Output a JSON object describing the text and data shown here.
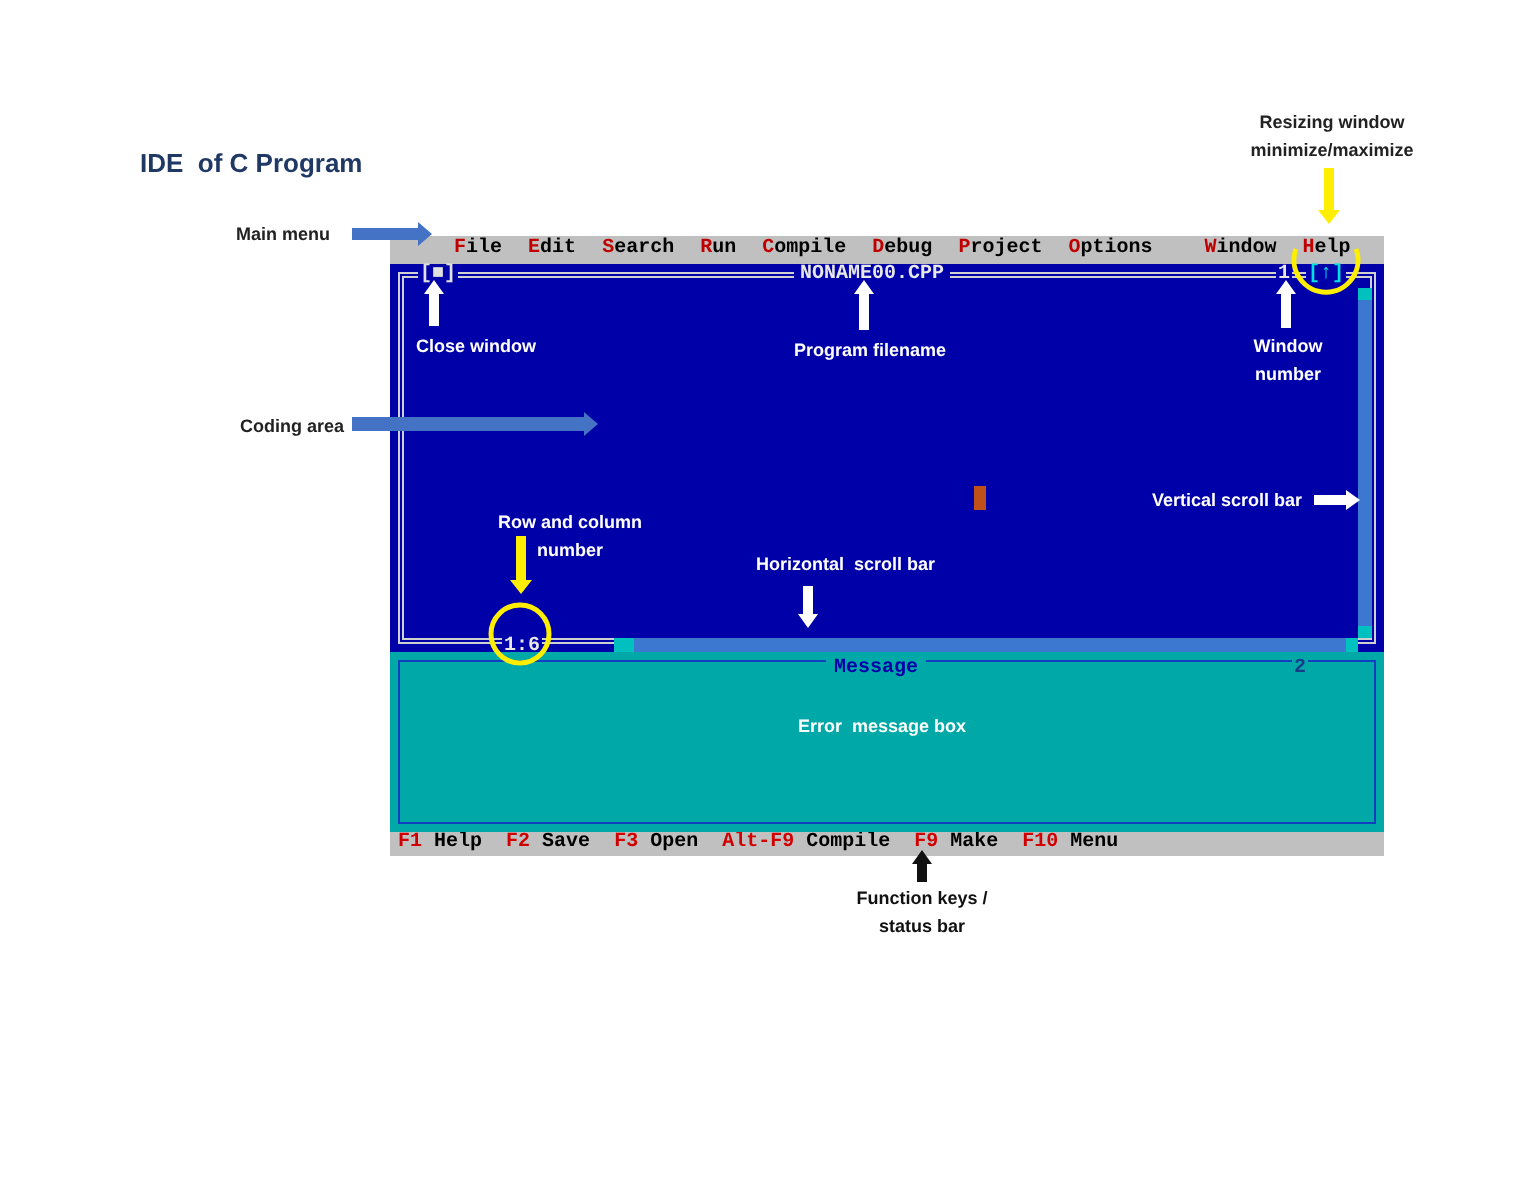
{
  "title": "IDE  of C Program",
  "ide": {
    "menu": [
      {
        "label": "File"
      },
      {
        "label": "Edit"
      },
      {
        "label": "Search"
      },
      {
        "label": "Run"
      },
      {
        "label": "Compile"
      },
      {
        "label": "Debug"
      },
      {
        "label": "Project"
      },
      {
        "label": "Options"
      },
      {
        "label": "Window"
      },
      {
        "label": "Help"
      }
    ],
    "editor": {
      "close_button": "[■]",
      "title": "NONAME00.CPP",
      "window_number": "1",
      "resize_button": "[↑]",
      "position": "1:6"
    },
    "message_window": {
      "title": "Message",
      "window_number": "2"
    },
    "status_bar": [
      {
        "key": "F1",
        "label": "Help"
      },
      {
        "key": "F2",
        "label": "Save"
      },
      {
        "key": "F3",
        "label": "Open"
      },
      {
        "key": "Alt-F9",
        "label": "Compile"
      },
      {
        "key": "F9",
        "label": "Make"
      },
      {
        "key": "F10",
        "label": "Menu"
      }
    ]
  },
  "annotations": [
    {
      "text": "Resizing window minimize/maximize"
    },
    {
      "text": "Main menu"
    },
    {
      "text": "Close window"
    },
    {
      "text": "Program filename"
    },
    {
      "text": "Window number"
    },
    {
      "text": "Coding area"
    },
    {
      "text": "Row and column number"
    },
    {
      "text": "Horizontal  scroll bar"
    },
    {
      "text": "Vertical scroll bar"
    },
    {
      "text": "Error  message box"
    },
    {
      "text": "Function keys / status bar"
    }
  ]
}
